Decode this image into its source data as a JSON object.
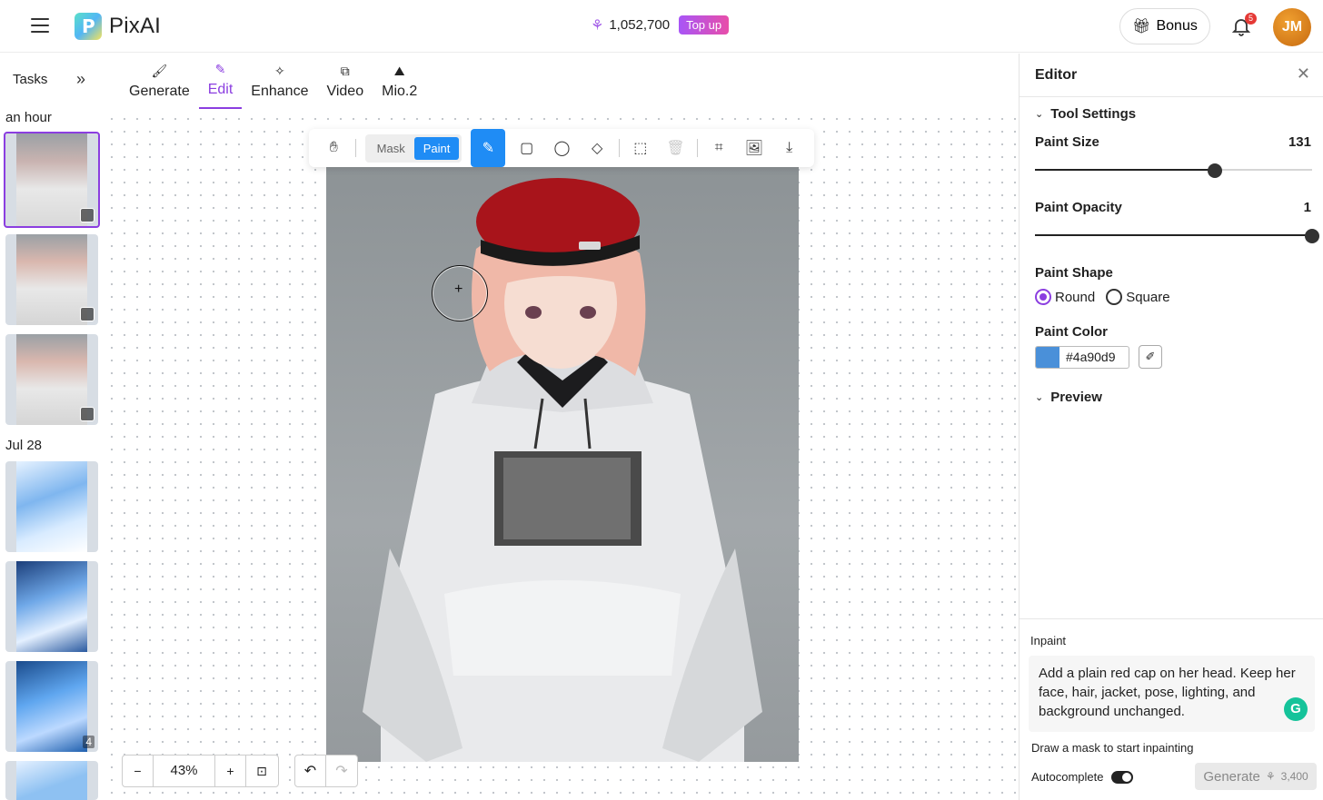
{
  "header": {
    "brand": "PixAI",
    "credits": "1,052,700",
    "topup_label": "Top up",
    "bonus_label": "Bonus",
    "notification_count": "5",
    "avatar_initials": "JM"
  },
  "sidebar": {
    "tasks_label": "Tasks",
    "groups": [
      {
        "label": "an hour"
      },
      {
        "label": "Jul 28"
      }
    ],
    "stack_count": "4"
  },
  "tabs": [
    {
      "label": "Generate",
      "icon": "brush-icon"
    },
    {
      "label": "Edit",
      "icon": "pencil-icon",
      "active": true
    },
    {
      "label": "Enhance",
      "icon": "sparkle-icon"
    },
    {
      "label": "Video",
      "icon": "video-icon"
    },
    {
      "label": "Mio.2",
      "icon": "mio-icon"
    }
  ],
  "toolbar": {
    "mask_label": "Mask",
    "paint_label": "Paint",
    "active_mode": "Paint"
  },
  "zoom": {
    "level": "43%"
  },
  "editor": {
    "title": "Editor",
    "tool_settings_label": "Tool Settings",
    "paint_size_label": "Paint Size",
    "paint_size_value": "131",
    "paint_size_fraction": 0.65,
    "paint_opacity_label": "Paint Opacity",
    "paint_opacity_value": "1",
    "paint_opacity_fraction": 1.0,
    "paint_shape_label": "Paint Shape",
    "shape_round": "Round",
    "shape_square": "Square",
    "selected_shape": "Round",
    "paint_color_label": "Paint Color",
    "paint_color_hex": "#4a90d9",
    "preview_label": "Preview"
  },
  "inpaint": {
    "label": "Inpaint",
    "prompt": "Add a plain red cap on her head. Keep her face, hair, jacket, pose, lighting, and background unchanged.",
    "mask_hint": "Draw a mask to start inpainting",
    "autocomplete_label": "Autocomplete",
    "generate_label": "Generate",
    "generate_cost": "3,400"
  },
  "colors": {
    "accent_purple": "#8b3ee0",
    "accent_blue": "#1f8cf5"
  }
}
